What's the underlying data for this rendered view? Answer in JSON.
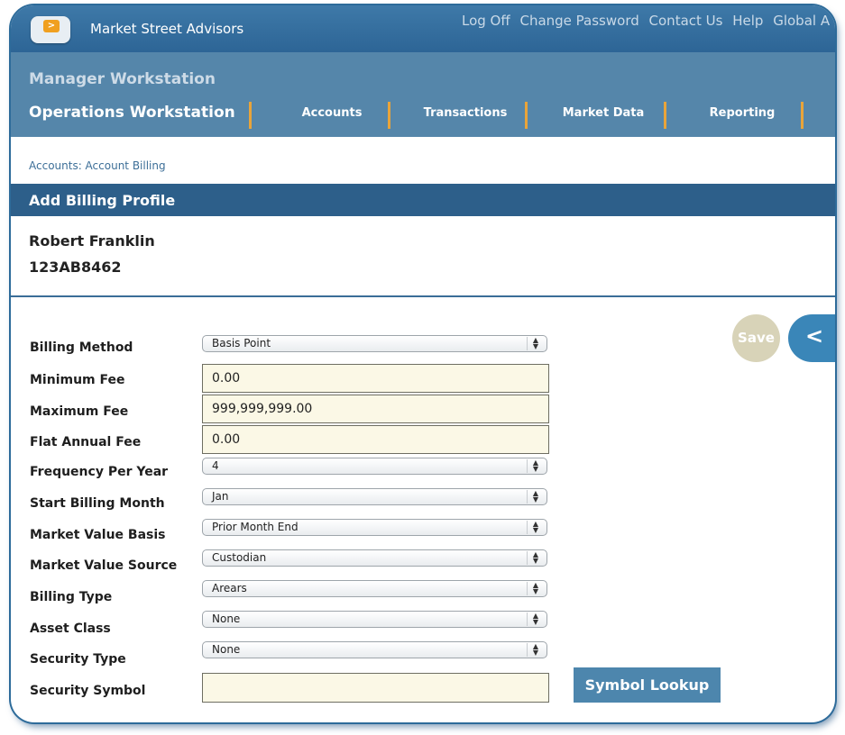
{
  "header": {
    "logo_glyph": ">",
    "brand": "Market Street Advisors",
    "links": [
      "Log Off",
      "Change Password",
      "Contact Us",
      "Help",
      "Global A"
    ]
  },
  "nav": {
    "manager_workstation": "Manager Workstation",
    "operations_workstation": "Operations Workstation",
    "tabs": [
      "Accounts",
      "Transactions",
      "Market Data",
      "Reporting"
    ]
  },
  "breadcrumb": "Accounts: Account Billing",
  "page_title": "Add Billing Profile",
  "account": {
    "name": "Robert Franklin",
    "number": "123AB8462"
  },
  "actions": {
    "save": "Save",
    "back": "<"
  },
  "form": {
    "billing_method": {
      "label": "Billing Method",
      "value": "Basis Point"
    },
    "minimum_fee": {
      "label": "Minimum Fee",
      "value": "0.00"
    },
    "maximum_fee": {
      "label": "Maximum Fee",
      "value": "999,999,999.00"
    },
    "flat_annual_fee": {
      "label": "Flat Annual Fee",
      "value": "0.00"
    },
    "frequency_per_year": {
      "label": "Frequency Per Year",
      "value": "4"
    },
    "start_billing_month": {
      "label": "Start Billing Month",
      "value": "Jan"
    },
    "market_value_basis": {
      "label": "Market Value Basis",
      "value": "Prior Month End"
    },
    "market_value_source": {
      "label": "Market Value Source",
      "value": "Custodian"
    },
    "billing_type": {
      "label": "Billing Type",
      "value": "Arears"
    },
    "asset_class": {
      "label": "Asset Class",
      "value": "None"
    },
    "security_type": {
      "label": "Security Type",
      "value": "None"
    },
    "security_symbol": {
      "label": "Security Symbol",
      "value": ""
    },
    "symbol_lookup": "Symbol Lookup"
  },
  "colors": {
    "header_blue": "#3e79a8",
    "nav_blue": "#5586aa",
    "title_band": "#2d5f8a",
    "accent_orange": "#e9a43a",
    "input_bg": "#fbf8e6",
    "save_disabled": "#d8d3b8",
    "back_button": "#3a86b8",
    "lookup_button": "#4d86ad"
  }
}
